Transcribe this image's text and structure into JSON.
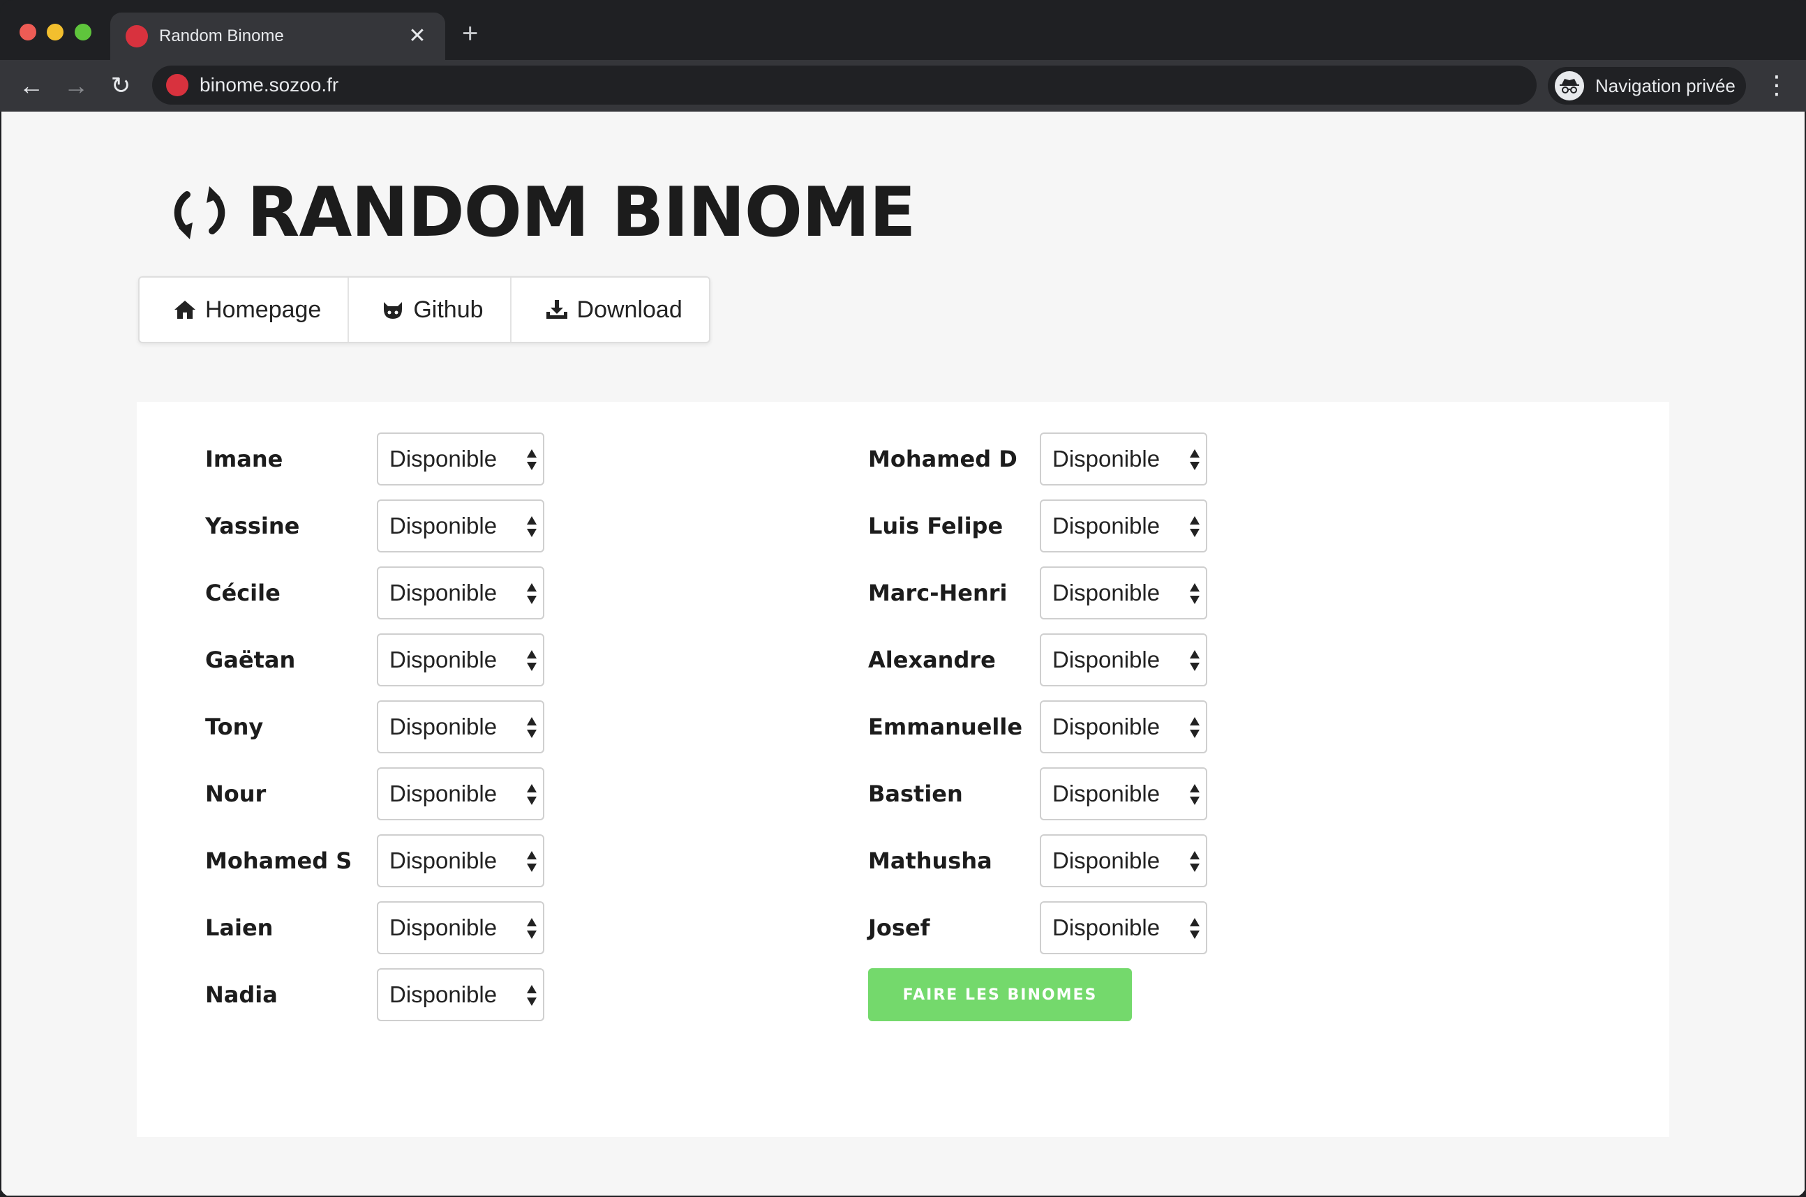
{
  "browser": {
    "tab_title": "Random Binome",
    "close_glyph": "✕",
    "new_tab_glyph": "+",
    "url": "binome.sozoo.fr",
    "incognito_label": "Navigation privée",
    "back_glyph": "←",
    "forward_glyph": "→",
    "reload_glyph": "↻",
    "menu_glyph": "⋮"
  },
  "page": {
    "title": "RANDOM BINOME",
    "nav": [
      {
        "label": "Homepage",
        "icon": "home-icon"
      },
      {
        "label": "Github",
        "icon": "github-icon"
      },
      {
        "label": "Download",
        "icon": "download-icon"
      }
    ]
  },
  "people": {
    "left": [
      {
        "name": "Imane",
        "status": "Disponible"
      },
      {
        "name": "Yassine",
        "status": "Disponible"
      },
      {
        "name": "Cécile",
        "status": "Disponible"
      },
      {
        "name": "Gaëtan",
        "status": "Disponible"
      },
      {
        "name": "Tony",
        "status": "Disponible"
      },
      {
        "name": "Nour",
        "status": "Disponible"
      },
      {
        "name": "Mohamed S",
        "status": "Disponible"
      },
      {
        "name": "Laien",
        "status": "Disponible"
      },
      {
        "name": "Nadia",
        "status": "Disponible"
      }
    ],
    "right": [
      {
        "name": "Mohamed D",
        "status": "Disponible"
      },
      {
        "name": "Luis Felipe",
        "status": "Disponible"
      },
      {
        "name": "Marc-Henri",
        "status": "Disponible"
      },
      {
        "name": "Alexandre",
        "status": "Disponible"
      },
      {
        "name": "Emmanuelle",
        "status": "Disponible"
      },
      {
        "name": "Bastien",
        "status": "Disponible"
      },
      {
        "name": "Mathusha",
        "status": "Disponible"
      },
      {
        "name": "Josef",
        "status": "Disponible"
      }
    ]
  },
  "action": {
    "label": "FAIRE LES BINOMES"
  },
  "colors": {
    "accent_green": "#74d96c",
    "favicon_red": "#d8323e"
  }
}
